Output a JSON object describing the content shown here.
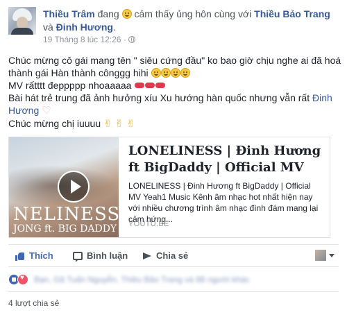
{
  "post": {
    "author": "Thiều Trâm",
    "status_prefix": "đang",
    "feeling": "cảm thấy ủng hôn cùng với",
    "tag_1": "Thiều Bảo Trang",
    "and_word": "và",
    "tag_2": "Đinh Hương",
    "period": ".",
    "timestamp": "19 Tháng 8 lúc 12:26 ·",
    "text_line1": "Chúc mừng cô gái mang tên \" siêu cứng đầu\" ko bao giờ chịu nghe ai đã hoá thành gái Hàn thành cônggg hihi",
    "text_line2": "MV rấtttt đeppppp nhoaaaaa",
    "text_line3": "Bài hát trẻ trung đã ảnh hưởng xíu Xu hướng hàn quốc nhưng vẫn rất",
    "text_line3_link": "Đinh Hương",
    "text_line4": "Chúc mừng chị iuuuu",
    "heart_glyph": "♡",
    "victory_glyph": "✌",
    "icons": [
      "grinning-emoji-icon",
      "lips-icon",
      "heart-icon",
      "victory-hand-icon",
      "globe-icon"
    ]
  },
  "preview": {
    "title": "LONELINESS | Đinh Hương ft BigDaddy | Official MV",
    "description": "LONELINESS | Đinh Hương ft BigDaddy | Official MV Yeah1 Music Kênh âm nhạc hot nhất hiện nay với nhiều chương trình âm nhạc đình đám mang lại cảm hứng...",
    "domain": "YOUTU.BE",
    "thumb_title": "NELINESS",
    "thumb_subtitle": "JONG ft. BIG DADDY",
    "icons": [
      "video-thumbnail",
      "play-icon"
    ]
  },
  "actions": {
    "like_label": "Thích",
    "comment_label": "Bình luận",
    "share_label": "Chia sẻ"
  },
  "reactions": {
    "names_blurred": "Bạn, Gã Tuấn Nguyễn, Thiều Bảo Trang và 88 người khác"
  },
  "shares_count": "4 lượt chia sẻ",
  "colors": {
    "link": "#365899",
    "accent": "#4267b2",
    "love": "#f25268",
    "text": "#1d2129",
    "muted": "#90949c"
  }
}
